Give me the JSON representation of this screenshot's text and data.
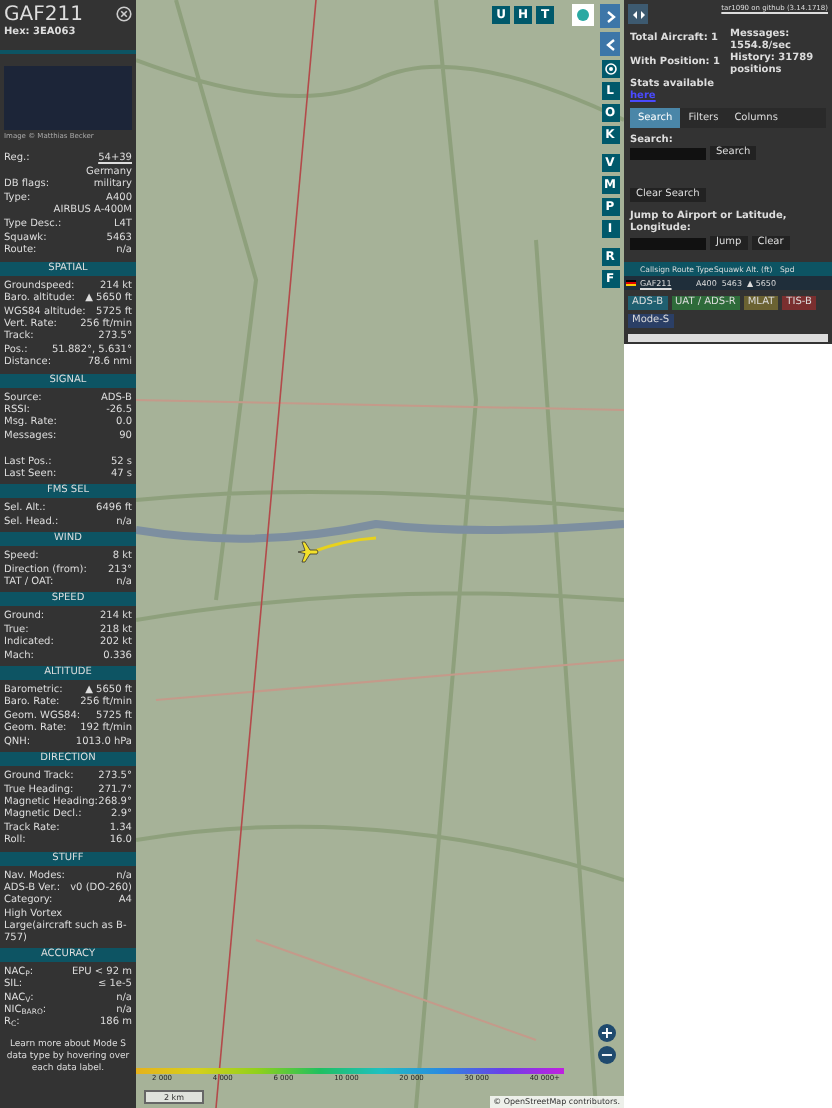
{
  "aircraft": {
    "callsign": "GAF211",
    "hex": "Hex: 3EA063",
    "photo_credit": "Image © Matthias Becker"
  },
  "info_rows": [
    {
      "label": "Reg.:",
      "value": "54+39",
      "link": true
    },
    {
      "label": "",
      "value": "Germany",
      "link": false
    },
    {
      "label": "DB flags:",
      "value": "military",
      "link": false
    },
    {
      "label": "Type:",
      "value": "A400",
      "link": false
    },
    {
      "label": "",
      "value": "AIRBUS A-400M",
      "link": false
    },
    {
      "label": "Type Desc.:",
      "value": "L4T",
      "link": false
    },
    {
      "label": "Squawk:",
      "value": "5463",
      "link": false
    },
    {
      "label": "Route:",
      "value": "n/a",
      "link": false
    }
  ],
  "sections": [
    {
      "title": "SPATIAL",
      "rows": [
        [
          "Groundspeed:",
          "214 kt"
        ],
        [
          "Baro. altitude:",
          "▲ 5650 ft"
        ],
        [
          "WGS84 altitude:",
          "5725 ft"
        ],
        [
          "Vert. Rate:",
          "256 ft/min"
        ],
        [
          "Track:",
          "273.5°"
        ],
        [
          "Pos.:",
          "51.882°, 5.631°"
        ],
        [
          "Distance:",
          "78.6 nmi"
        ]
      ]
    },
    {
      "title": "SIGNAL",
      "rows": [
        [
          "Source:",
          "ADS-B"
        ],
        [
          "RSSI:",
          "-26.5"
        ],
        [
          "Msg. Rate:",
          "0.0"
        ],
        [
          "Messages:",
          "90"
        ],
        [
          "",
          ""
        ],
        [
          "Last Pos.:",
          "52 s"
        ],
        [
          "Last Seen:",
          "47 s"
        ]
      ]
    },
    {
      "title": "FMS SEL",
      "rows": [
        [
          "Sel. Alt.:",
          "6496 ft"
        ],
        [
          "Sel. Head.:",
          "n/a"
        ]
      ]
    },
    {
      "title": "WIND",
      "rows": [
        [
          "Speed:",
          "8 kt"
        ],
        [
          "Direction (from):",
          "213°"
        ],
        [
          "TAT / OAT:",
          "n/a"
        ]
      ]
    },
    {
      "title": "SPEED",
      "rows": [
        [
          "Ground:",
          "214 kt"
        ],
        [
          "True:",
          "218 kt"
        ],
        [
          "Indicated:",
          "202 kt"
        ],
        [
          "Mach:",
          "0.336"
        ]
      ]
    },
    {
      "title": "ALTITUDE",
      "rows": [
        [
          "Barometric:",
          "▲ 5650 ft"
        ],
        [
          "Baro. Rate:",
          "256 ft/min"
        ],
        [
          "Geom. WGS84:",
          "5725 ft"
        ],
        [
          "Geom. Rate:",
          "192 ft/min"
        ],
        [
          "QNH:",
          "1013.0 hPa"
        ]
      ]
    },
    {
      "title": "DIRECTION",
      "rows": [
        [
          "Ground Track:",
          "273.5°"
        ],
        [
          "True Heading:",
          "271.7°"
        ],
        [
          "Magnetic Heading:",
          "268.9°"
        ],
        [
          "Magnetic Decl.:",
          "2.9°"
        ],
        [
          "Track Rate:",
          "1.34"
        ],
        [
          "Roll:",
          "16.0"
        ]
      ]
    },
    {
      "title": "STUFF",
      "rows": [
        [
          "Nav. Modes:",
          "n/a"
        ],
        [
          "ADS-B Ver.:",
          "v0 (DO-260)"
        ],
        [
          "Category:",
          "A4"
        ],
        [
          "High Vortex Large(aircraft such as B-757)",
          ""
        ]
      ]
    },
    {
      "title": "ACCURACY",
      "rows": [
        [
          "NAC$_{P}$:",
          "EPU < 92 m"
        ],
        [
          "SIL:",
          "≤ 1e-5"
        ],
        [
          "NAC$_{V}$:",
          "n/a"
        ],
        [
          "NIC$_{BARO}$:",
          "n/a"
        ],
        [
          "R$_{C}$:",
          "186 m"
        ]
      ]
    }
  ],
  "footer_note": "Learn more about Mode S data type by hovering over each data label.",
  "map": {
    "top_buttons": [
      "U",
      "H",
      "T"
    ],
    "side_buttons": [
      "L",
      "O",
      "K",
      "V",
      "M",
      "P",
      "I",
      "R",
      "F"
    ],
    "zoom_in": "+",
    "zoom_out": "−",
    "scale": "2 km",
    "attribution": "© OpenStreetMap contributors.",
    "legend": [
      "2 000",
      "4 000",
      "6 000",
      "10 000",
      "20 000",
      "30 000",
      "40 000+"
    ]
  },
  "panel": {
    "version_link": "tar1090 on github (3.14.1718)",
    "total": "Total Aircraft: 1",
    "messages": "Messages: 1554.8/sec",
    "with_position": "With Position: 1",
    "history": "History: 31789 positions",
    "stats": "Stats available",
    "stats_link": "here",
    "tabs": [
      {
        "label": "Search",
        "selected": true
      },
      {
        "label": "Filters",
        "selected": false
      },
      {
        "label": "Columns",
        "selected": false
      }
    ],
    "search_label": "Search:",
    "search_button": "Search",
    "clear_search": "Clear Search",
    "jump_label": "Jump to Airport or Latitude, Longitude:",
    "jump_button": "Jump",
    "clear_button": "Clear",
    "table": {
      "columns": [
        "Callsign",
        "Route",
        "Type",
        "Squawk",
        "Alt. (ft)",
        "Spd"
      ],
      "rows": [
        {
          "callsign": "GAF211",
          "route": "",
          "type": "A400",
          "squawk": "5463",
          "alt": "▲ 5650",
          "selected": true
        }
      ]
    },
    "badges": [
      {
        "label": "ADS-B",
        "color": "#1f5f70"
      },
      {
        "label": "UAT / ADS-R",
        "color": "#2e6b3a"
      },
      {
        "label": "MLAT",
        "color": "#6b6232"
      },
      {
        "label": "TIS-B",
        "color": "#7a2f2f"
      },
      {
        "label": "Mode-S",
        "color": "#2b3f66"
      }
    ]
  }
}
